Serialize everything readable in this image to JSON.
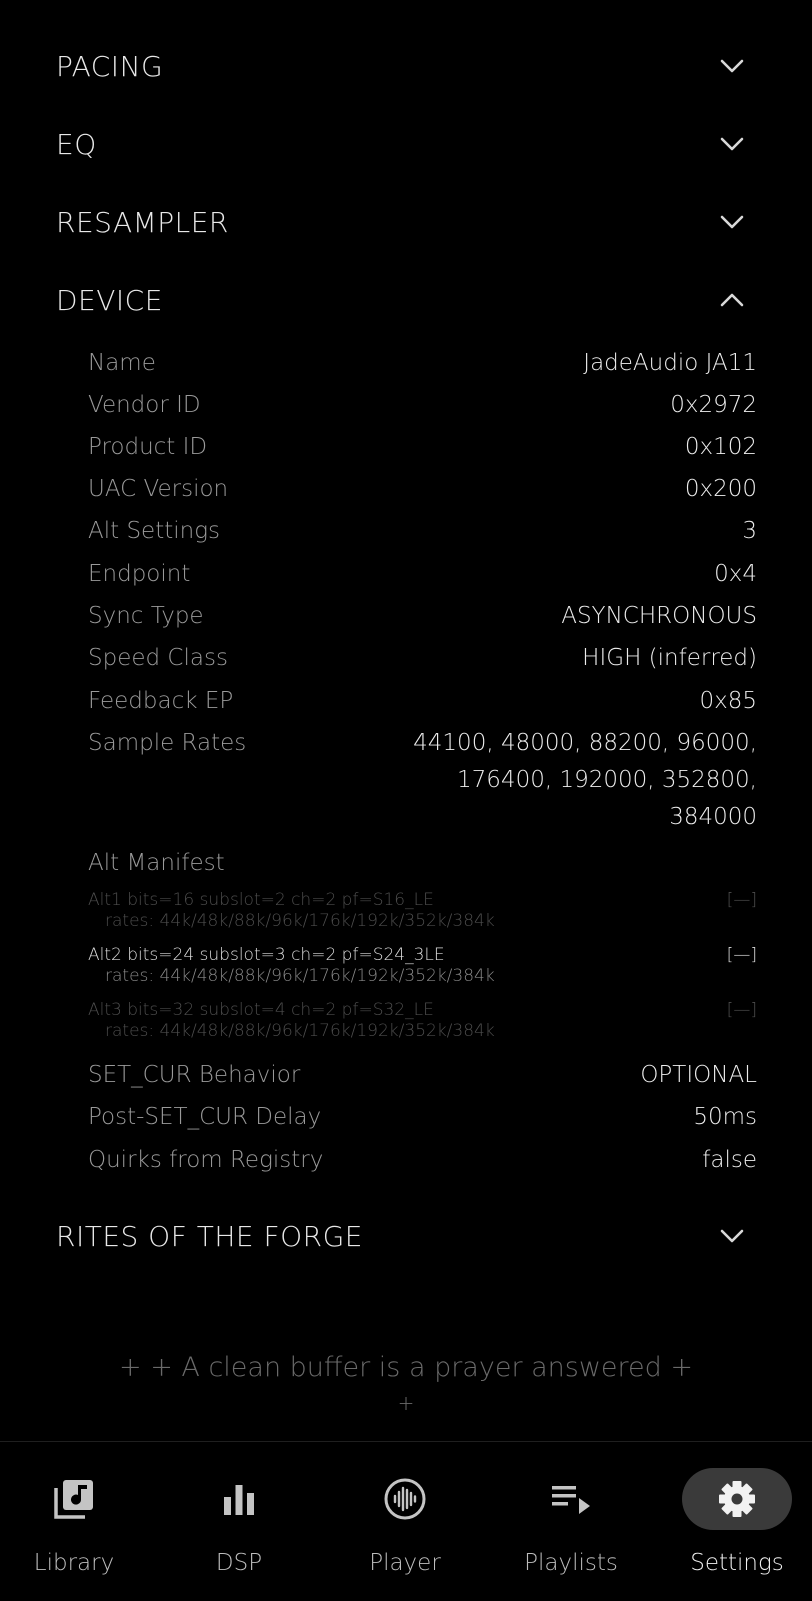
{
  "sections": {
    "pacing": "PACING",
    "eq": "EQ",
    "resampler": "RESAMPLER",
    "device": "DEVICE",
    "rites": "RITES OF THE FORGE"
  },
  "device": {
    "fields": [
      {
        "key": "Name",
        "value": "JadeAudio JA11"
      },
      {
        "key": "Vendor ID",
        "value": "0x2972"
      },
      {
        "key": "Product ID",
        "value": "0x102"
      },
      {
        "key": "UAC Version",
        "value": "0x200"
      },
      {
        "key": "Alt Settings",
        "value": "3"
      },
      {
        "key": "Endpoint",
        "value": "0x4"
      },
      {
        "key": "Sync Type",
        "value": "ASYNCHRONOUS"
      },
      {
        "key": "Speed Class",
        "value": "HIGH (inferred)"
      },
      {
        "key": "Feedback EP",
        "value": "0x85"
      }
    ],
    "sample_rates": {
      "key": "Sample Rates",
      "lines": [
        "44100, 48000, 88200, 96000,",
        "176400, 192000, 352800,",
        "384000"
      ]
    },
    "alt_manifest_label": "Alt Manifest",
    "alt_manifest": [
      {
        "line": "Alt1  bits=16  subslot=2  ch=2  pf=S16_LE",
        "rates": "rates: 44k/48k/88k/96k/176k/192k/352k/384k",
        "marker": "[—]",
        "active": false
      },
      {
        "line": "Alt2  bits=24  subslot=3  ch=2  pf=S24_3LE",
        "rates": "rates: 44k/48k/88k/96k/176k/192k/352k/384k",
        "marker": "[—]",
        "active": true
      },
      {
        "line": "Alt3  bits=32  subslot=4  ch=2  pf=S32_LE",
        "rates": "rates: 44k/48k/88k/96k/176k/192k/352k/384k",
        "marker": "[—]",
        "active": false
      }
    ],
    "tail_fields": [
      {
        "key": "SET_CUR Behavior",
        "value": "OPTIONAL"
      },
      {
        "key": "Post-SET_CUR Delay",
        "value": "50ms"
      },
      {
        "key": "Quirks from Registry",
        "value": "false"
      }
    ]
  },
  "motto": {
    "line1": "+ +  A clean buffer is a prayer answered  +",
    "line2": "+"
  },
  "nav": [
    {
      "label": "Library",
      "icon": "library-icon",
      "active": false
    },
    {
      "label": "DSP",
      "icon": "bar-chart-icon",
      "active": false
    },
    {
      "label": "Player",
      "icon": "waveform-icon",
      "active": false
    },
    {
      "label": "Playlists",
      "icon": "playlist-icon",
      "active": false
    },
    {
      "label": "Settings",
      "icon": "gear-icon",
      "active": true
    }
  ]
}
